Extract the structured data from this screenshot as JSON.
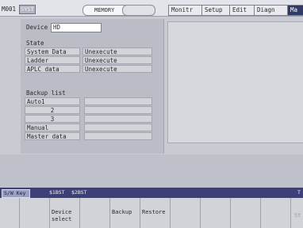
{
  "header": {
    "part_system": "M001",
    "system_label": "SYST",
    "mode": "MEMORY",
    "tabs": [
      {
        "label": "Monitr",
        "active": false
      },
      {
        "label": "Setup",
        "active": false
      },
      {
        "label": "Edit",
        "active": false
      },
      {
        "label": "Diagn",
        "active": false
      },
      {
        "label": "Ma",
        "active": true
      }
    ]
  },
  "device": {
    "label": "Device",
    "value": "HD"
  },
  "state": {
    "title": "State",
    "rows": [
      {
        "name": "System Data",
        "value": "Unexecute"
      },
      {
        "name": "Ladder",
        "value": "Unexecute"
      },
      {
        "name": "APLC data",
        "value": "Unexecute"
      }
    ]
  },
  "backup": {
    "title": "Backup list",
    "rows": [
      {
        "name": "Auto1",
        "value": ""
      },
      {
        "name": "2",
        "value": ""
      },
      {
        "name": "3",
        "value": ""
      },
      {
        "name": "Manual",
        "value": ""
      },
      {
        "name": "Master data",
        "value": ""
      }
    ]
  },
  "softkey_bar": {
    "sw_key": "S/W Key",
    "items": [
      "$1BST",
      "$2BST"
    ],
    "right_marker": "T"
  },
  "function_keys": [
    {
      "label": ""
    },
    {
      "label": "Device\nselect"
    },
    {
      "label": ""
    },
    {
      "label": "Backup"
    },
    {
      "label": "Restore"
    },
    {
      "label": ""
    },
    {
      "label": ""
    },
    {
      "label": ""
    },
    {
      "label": ""
    },
    {
      "label": "St"
    }
  ],
  "colors": {
    "active_tab": "#2f3a66",
    "softkey_bar": "#3d3f78",
    "background": "#c9cbd2"
  }
}
